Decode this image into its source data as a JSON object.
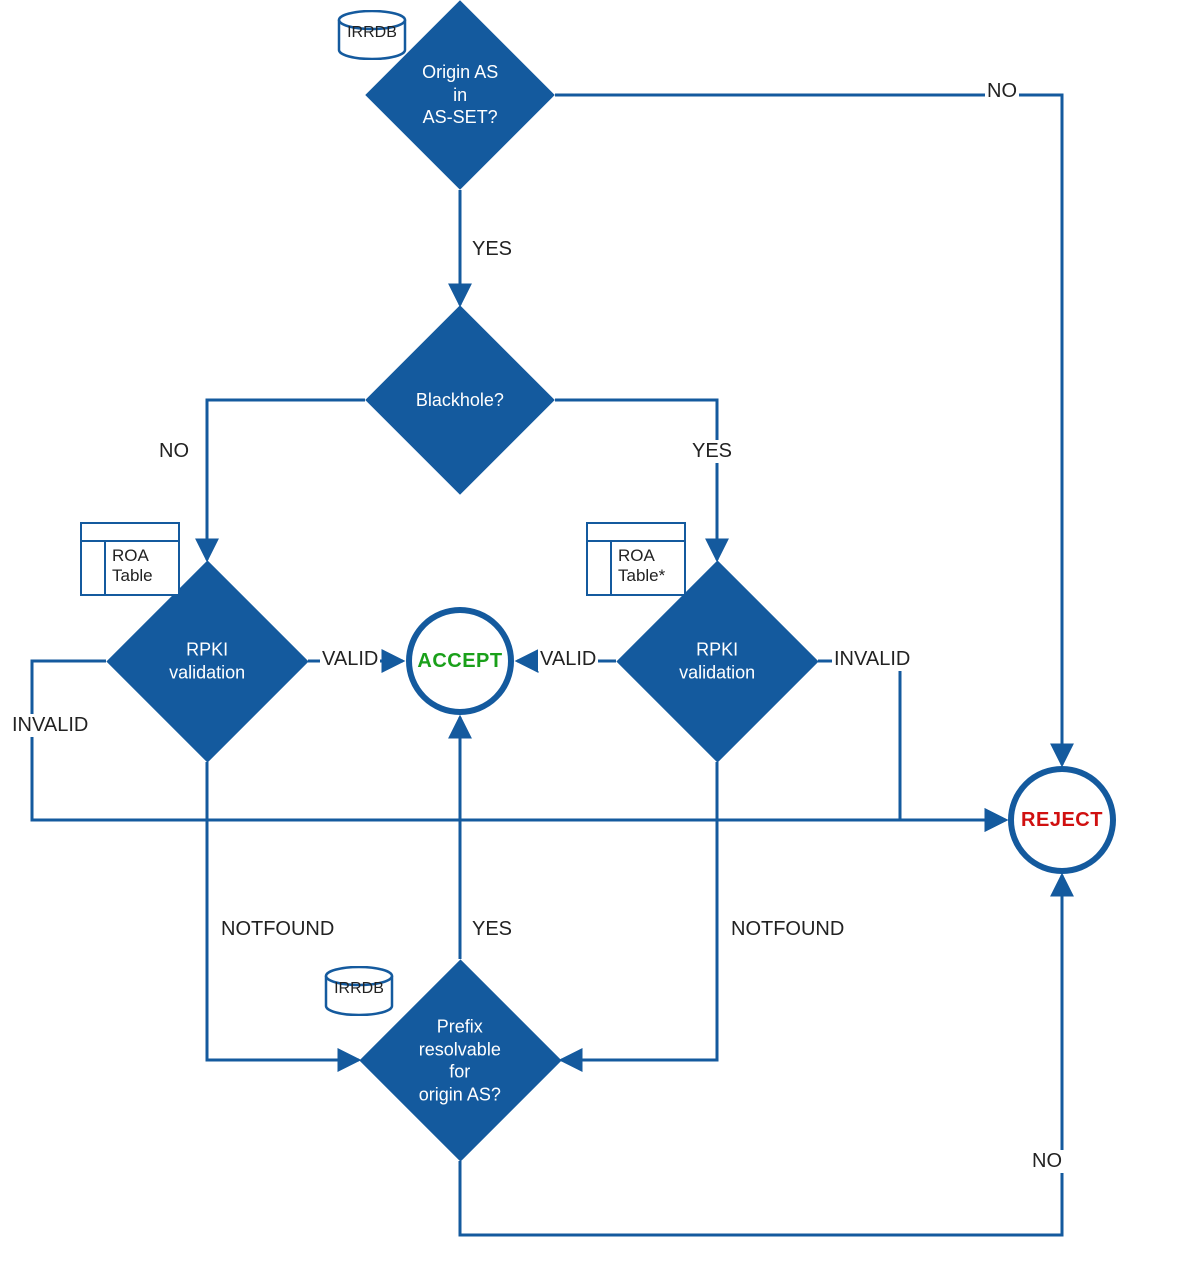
{
  "colors": {
    "brand": "#145a9e",
    "accept": "#1aa01a",
    "reject": "#d01010"
  },
  "nodes": {
    "origin_as_in_asset": "Origin AS\nin\nAS-SET?",
    "blackhole": "Blackhole?",
    "rpki_left": "RPKI\nvalidation",
    "rpki_right": "RPKI\nvalidation",
    "prefix_resolvable": "Prefix\nresolvable\nfor\norigin AS?",
    "accept": "ACCEPT",
    "reject": "REJECT"
  },
  "edge_labels": {
    "origin_no": "NO",
    "origin_yes": "YES",
    "blackhole_no": "NO",
    "blackhole_yes": "YES",
    "rpki_left_valid": "VALID",
    "rpki_left_invalid": "INVALID",
    "rpki_left_notfound": "NOTFOUND",
    "rpki_right_valid": "VALID",
    "rpki_right_invalid": "INVALID",
    "rpki_right_notfound": "NOTFOUND",
    "prefix_yes": "YES",
    "prefix_no": "NO"
  },
  "datastores": {
    "irrdb_top": "IRRDB",
    "irrdb_bottom": "IRRDB",
    "roa_left": "ROA\nTable",
    "roa_right": "ROA\nTable*"
  }
}
